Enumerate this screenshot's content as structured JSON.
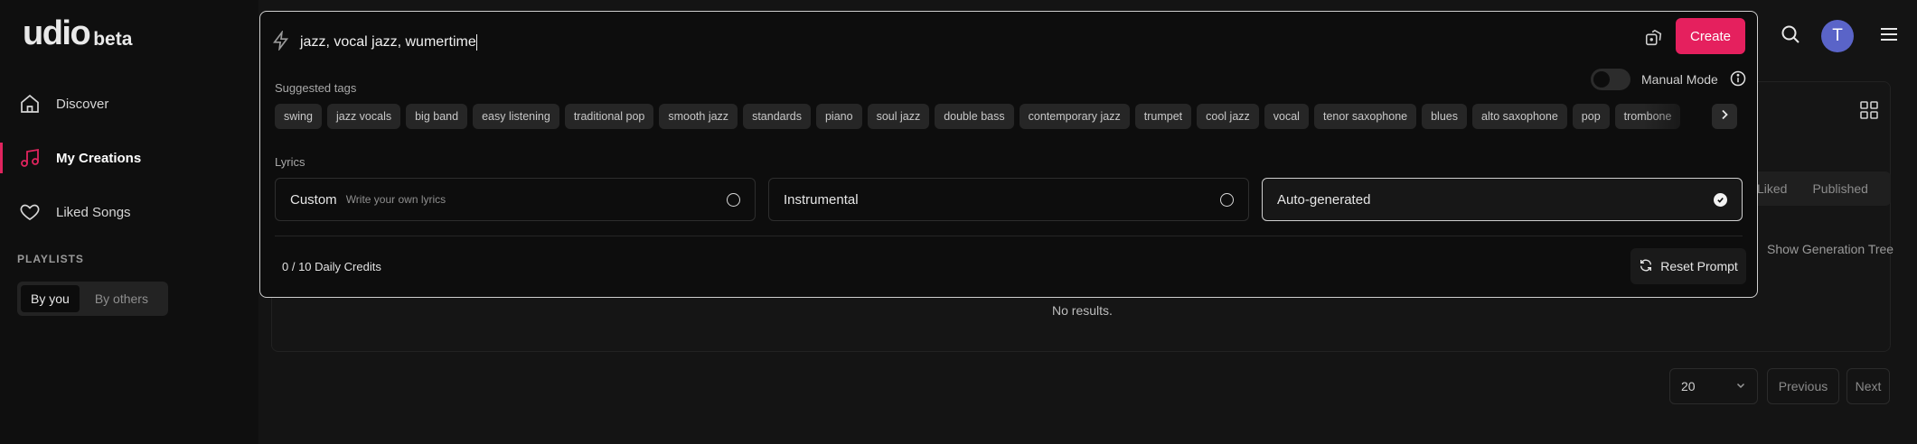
{
  "logo": {
    "name": "udio",
    "tag": "beta"
  },
  "sidebar": {
    "items": [
      {
        "label": "Discover",
        "icon": "home-icon"
      },
      {
        "label": "My Creations",
        "icon": "music-note-icon",
        "active": true
      },
      {
        "label": "Liked Songs",
        "icon": "heart-icon"
      }
    ],
    "playlists_label": "PLAYLISTS",
    "playlist_filters": [
      "By you",
      "By others"
    ],
    "playlist_filter_selected": "By you"
  },
  "header": {
    "avatar_initial": "T"
  },
  "create": {
    "prompt_value": "jazz, vocal jazz, wumertime",
    "create_label": "Create",
    "suggested_label": "Suggested tags",
    "manual_mode_label": "Manual Mode",
    "manual_mode_on": false,
    "tags": [
      "swing",
      "jazz vocals",
      "big band",
      "easy listening",
      "traditional pop",
      "smooth jazz",
      "standards",
      "piano",
      "soul jazz",
      "double bass",
      "contemporary jazz",
      "trumpet",
      "cool jazz",
      "vocal",
      "tenor saxophone",
      "blues",
      "alto saxophone",
      "pop",
      "trombone"
    ],
    "lyrics_label": "Lyrics",
    "lyrics_options": [
      {
        "label": "Custom",
        "sub": "Write your own lyrics"
      },
      {
        "label": "Instrumental",
        "sub": ""
      },
      {
        "label": "Auto-generated",
        "sub": "",
        "selected": true
      }
    ],
    "credits": "0 / 10 Daily Credits",
    "reset_label": "Reset Prompt"
  },
  "content": {
    "tabs": [
      "Liked",
      "Published"
    ],
    "generation_tree": "Show Generation Tree",
    "no_results": "No results.",
    "page_size": "20",
    "prev": "Previous",
    "next": "Next"
  },
  "colors": {
    "accent": "#e5205e",
    "avatar": "#5a64c8"
  }
}
